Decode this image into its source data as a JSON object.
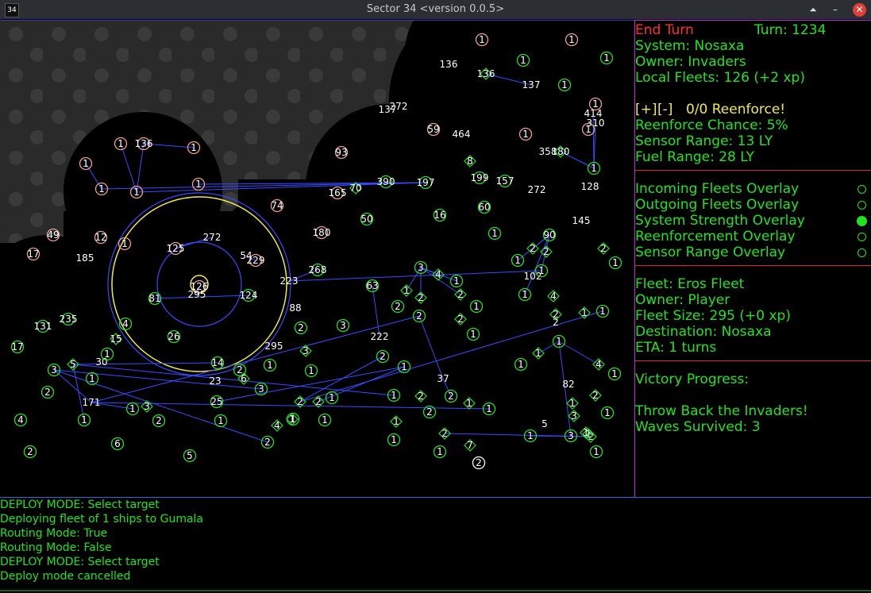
{
  "window": {
    "icon_text": "34",
    "title": "Sector 34   <version 0.0.5>",
    "buttons": {
      "up": "⏶",
      "minimize": "–",
      "close": "✕"
    }
  },
  "colors": {
    "enemy": "#f2a08e",
    "player": "#21e321",
    "neutral": "#ffffff",
    "sensor_circle": "#3a4cff",
    "range_circle": "#f2ea4a",
    "accent_red": "#ff3030",
    "accent_yellow": "#f2ea4a",
    "separator": "#d8272b"
  },
  "sidepanel": {
    "end_turn": "End Turn",
    "turn": "Turn: 1234",
    "system": "System: Nosaxa",
    "owner": "Owner: Invaders",
    "local_fleets": "Local Fleets: 126 (+2 xp)",
    "reinforce_plus": "[+]",
    "reinforce_minus": "[-]",
    "reinforce_status": "0/0 Reenforce!",
    "reinforce_chance": "Reenforce Chance: 5%",
    "sensor_range": "Sensor Range: 13 LY",
    "fuel_range": "Fuel Range: 28 LY",
    "overlays": [
      {
        "label": "Incoming Fleets Overlay",
        "on": false
      },
      {
        "label": "Outgoing Fleets Overlay",
        "on": false
      },
      {
        "label": "System Strength Overlay",
        "on": true
      },
      {
        "label": "Reenforcement Overlay",
        "on": false
      },
      {
        "label": "Sensor Range Overlay",
        "on": false
      }
    ],
    "fleet_name": "Fleet: Eros Fleet",
    "fleet_owner": "Owner: Player",
    "fleet_size": "Fleet Size: 295 (+0 xp)",
    "destination": "Destination: Nosaxa",
    "eta": "ETA: 1 turns",
    "victory_progress": "Victory Progress:",
    "objective": "Throw Back the Invaders!",
    "waves": "Waves Survived: 3"
  },
  "console": {
    "lines": [
      "DEPLOY MODE: Select target",
      "Deploying fleet of 1 ships to Gumala",
      "Routing Mode: True",
      "Routing Mode: False",
      "DEPLOY MODE: Select target",
      "Deploy mode cancelled"
    ]
  },
  "map": {
    "systems": [
      {
        "label": "1",
        "owner": "enemy"
      },
      {
        "label": "1",
        "owner": "enemy"
      },
      {
        "label": "136",
        "owner": "enemy"
      },
      {
        "label": "1",
        "owner": "player"
      },
      {
        "label": "1",
        "owner": "player"
      },
      {
        "label": "136",
        "owner": "neutral"
      },
      {
        "label": "137",
        "owner": "enemy"
      },
      {
        "label": "1",
        "owner": "player"
      },
      {
        "label": "137",
        "owner": "enemy"
      },
      {
        "label": "272",
        "owner": "neutral"
      },
      {
        "label": "414",
        "owner": "neutral"
      },
      {
        "label": "1",
        "owner": "enemy"
      },
      {
        "label": "310",
        "owner": "neutral"
      },
      {
        "label": "1",
        "owner": "enemy"
      },
      {
        "label": "59",
        "owner": "enemy"
      },
      {
        "label": "464",
        "owner": "neutral"
      },
      {
        "label": "1",
        "owner": "enemy"
      },
      {
        "label": "358",
        "owner": "enemy"
      },
      {
        "label": "180",
        "owner": "neutral"
      },
      {
        "label": "1",
        "owner": "player"
      },
      {
        "label": "93",
        "owner": "enemy"
      },
      {
        "label": "8",
        "owner": "neutral"
      },
      {
        "label": "1",
        "owner": "enemy"
      },
      {
        "label": "136",
        "owner": "enemy"
      },
      {
        "label": "1",
        "owner": "enemy"
      },
      {
        "label": "1",
        "owner": "enemy"
      },
      {
        "label": "1",
        "owner": "enemy"
      },
      {
        "label": "1",
        "owner": "enemy"
      },
      {
        "label": "1",
        "owner": "enemy"
      },
      {
        "label": "199",
        "owner": "player"
      },
      {
        "label": "157",
        "owner": "player"
      },
      {
        "label": "390",
        "owner": "player"
      },
      {
        "label": "197",
        "owner": "player"
      },
      {
        "label": "272",
        "owner": "neutral"
      },
      {
        "label": "128",
        "owner": "neutral"
      },
      {
        "label": "165",
        "owner": "enemy"
      },
      {
        "label": "70",
        "owner": "neutral"
      },
      {
        "label": "50",
        "owner": "player"
      },
      {
        "label": "16",
        "owner": "player"
      },
      {
        "label": "60",
        "owner": "player"
      },
      {
        "label": "1",
        "owner": "player"
      },
      {
        "label": "145",
        "owner": "neutral"
      },
      {
        "label": "74",
        "owner": "enemy"
      },
      {
        "label": "49",
        "owner": "enemy"
      },
      {
        "label": "12",
        "owner": "enemy"
      },
      {
        "label": "1",
        "owner": "enemy"
      },
      {
        "label": "180",
        "owner": "enemy"
      },
      {
        "label": "17",
        "owner": "enemy"
      },
      {
        "label": "185",
        "owner": "enemy"
      },
      {
        "label": "125",
        "owner": "enemy"
      },
      {
        "label": "272",
        "owner": "neutral"
      },
      {
        "label": "54",
        "owner": "neutral"
      },
      {
        "label": "229",
        "owner": "enemy"
      },
      {
        "label": "90",
        "owner": "player"
      },
      {
        "label": "2",
        "owner": "neutral"
      },
      {
        "label": "2",
        "owner": "neutral"
      },
      {
        "label": "2",
        "owner": "neutral"
      },
      {
        "label": "1",
        "owner": "player"
      },
      {
        "label": "102",
        "owner": "neutral"
      },
      {
        "label": "1",
        "owner": "player"
      },
      {
        "label": "268",
        "owner": "player"
      },
      {
        "label": "223",
        "owner": "neutral"
      },
      {
        "label": "3",
        "owner": "player"
      },
      {
        "label": "4",
        "owner": "neutral"
      },
      {
        "label": "1",
        "owner": "player"
      },
      {
        "label": "126",
        "owner": "enemy"
      },
      {
        "label": "295",
        "owner": "neutral"
      },
      {
        "label": "81",
        "owner": "player"
      },
      {
        "label": "124",
        "owner": "player"
      },
      {
        "label": "63",
        "owner": "player"
      },
      {
        "label": "1",
        "owner": "neutral"
      },
      {
        "label": "2",
        "owner": "neutral"
      },
      {
        "label": "2",
        "owner": "neutral"
      },
      {
        "label": "1",
        "owner": "player"
      },
      {
        "label": "88",
        "owner": "neutral"
      },
      {
        "label": "1",
        "owner": "player"
      },
      {
        "label": "2",
        "owner": "player"
      },
      {
        "label": "2",
        "owner": "neutral"
      },
      {
        "label": "1",
        "owner": "player"
      },
      {
        "label": "4",
        "owner": "neutral"
      },
      {
        "label": "2",
        "owner": "neutral"
      },
      {
        "label": "1",
        "owner": "neutral"
      },
      {
        "label": "1",
        "owner": "player"
      },
      {
        "label": "235",
        "owner": "player"
      },
      {
        "label": "131",
        "owner": "player"
      },
      {
        "label": "4",
        "owner": "player"
      },
      {
        "label": "2",
        "owner": "player"
      },
      {
        "label": "3",
        "owner": "player"
      },
      {
        "label": "2",
        "owner": "player"
      },
      {
        "label": "1",
        "owner": "player"
      },
      {
        "label": "2",
        "owner": "neutral"
      },
      {
        "label": "222",
        "owner": "neutral"
      },
      {
        "label": "15",
        "owner": "neutral"
      },
      {
        "label": "26",
        "owner": "player"
      },
      {
        "label": "295",
        "owner": "neutral"
      },
      {
        "label": "3",
        "owner": "neutral"
      },
      {
        "label": "17",
        "owner": "player"
      },
      {
        "label": "2",
        "owner": "player"
      },
      {
        "label": "1",
        "owner": "neutral"
      },
      {
        "label": "1",
        "owner": "player"
      },
      {
        "label": "5",
        "owner": "neutral"
      },
      {
        "label": "30",
        "owner": "neutral"
      },
      {
        "label": "1",
        "owner": "player"
      },
      {
        "label": "14",
        "owner": "player"
      },
      {
        "label": "2",
        "owner": "player"
      },
      {
        "label": "1",
        "owner": "player"
      },
      {
        "label": "1",
        "owner": "player"
      },
      {
        "label": "4",
        "owner": "neutral"
      },
      {
        "label": "1",
        "owner": "player"
      },
      {
        "label": "3",
        "owner": "player"
      },
      {
        "label": "1",
        "owner": "player"
      },
      {
        "label": "6",
        "owner": "neutral"
      },
      {
        "label": "23",
        "owner": "neutral"
      },
      {
        "label": "3",
        "owner": "player"
      },
      {
        "label": "1",
        "owner": "player"
      },
      {
        "label": "37",
        "owner": "neutral"
      },
      {
        "label": "82",
        "owner": "neutral"
      },
      {
        "label": "2",
        "owner": "player"
      },
      {
        "label": "1",
        "owner": "player"
      },
      {
        "label": "2",
        "owner": "neutral"
      },
      {
        "label": "2",
        "owner": "player"
      },
      {
        "label": "1",
        "owner": "neutral"
      },
      {
        "label": "1",
        "owner": "player"
      },
      {
        "label": "2",
        "owner": "neutral"
      },
      {
        "label": "171",
        "owner": "neutral"
      },
      {
        "label": "1",
        "owner": "player"
      },
      {
        "label": "3",
        "owner": "neutral"
      },
      {
        "label": "2",
        "owner": "player"
      },
      {
        "label": "25",
        "owner": "player"
      },
      {
        "label": "2",
        "owner": "neutral"
      },
      {
        "label": "1",
        "owner": "player"
      },
      {
        "label": "2",
        "owner": "neutral"
      },
      {
        "label": "1",
        "owner": "player"
      },
      {
        "label": "1",
        "owner": "neutral"
      },
      {
        "label": "2",
        "owner": "player"
      },
      {
        "label": "1",
        "owner": "neutral"
      },
      {
        "label": "1",
        "owner": "player"
      },
      {
        "label": "3",
        "owner": "neutral"
      },
      {
        "label": "5",
        "owner": "neutral"
      },
      {
        "label": "1",
        "owner": "player"
      },
      {
        "label": "1",
        "owner": "player"
      },
      {
        "label": "1",
        "owner": "neutral"
      },
      {
        "label": "4",
        "owner": "player"
      },
      {
        "label": "3",
        "owner": "player"
      },
      {
        "label": "2",
        "owner": "player"
      },
      {
        "label": "4",
        "owner": "neutral"
      },
      {
        "label": "1",
        "owner": "player"
      },
      {
        "label": "1",
        "owner": "player"
      },
      {
        "label": "2",
        "owner": "player"
      },
      {
        "label": "2",
        "owner": "neutral"
      },
      {
        "label": "7",
        "owner": "neutral"
      },
      {
        "label": "1",
        "owner": "player"
      },
      {
        "label": "6",
        "owner": "player"
      },
      {
        "label": "5",
        "owner": "player"
      },
      {
        "label": "2",
        "owner": "player"
      },
      {
        "label": "1",
        "owner": "player"
      },
      {
        "label": "1",
        "owner": "player"
      },
      {
        "label": "2",
        "owner": "neutral"
      },
      {
        "label": "1",
        "owner": "neutral"
      },
      {
        "label": "1",
        "owner": "player"
      },
      {
        "label": "1",
        "owner": "neutral"
      }
    ]
  }
}
